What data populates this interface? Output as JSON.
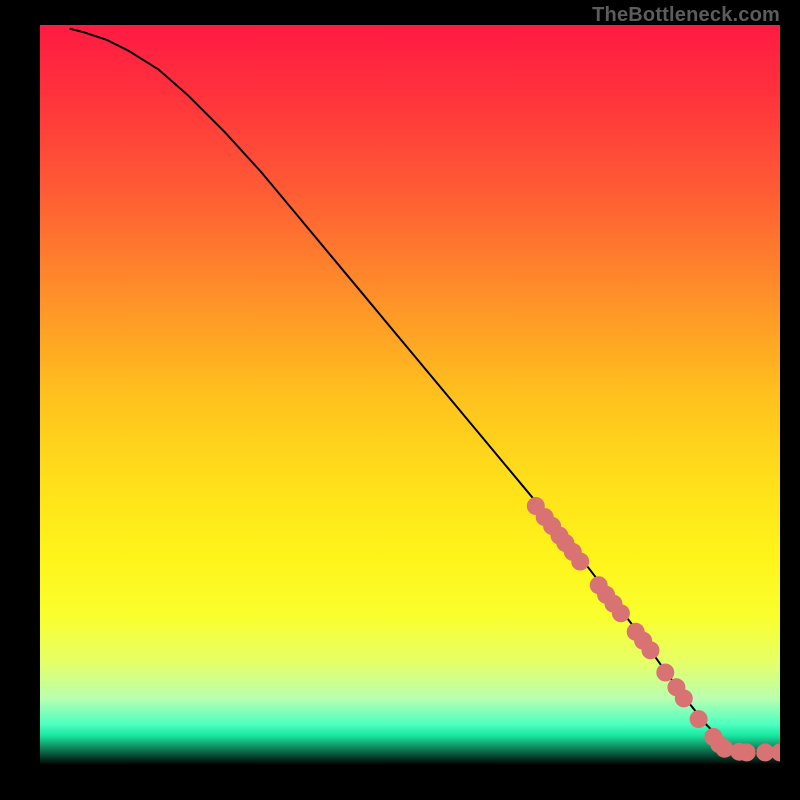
{
  "watermark": "TheBottleneck.com",
  "colors": {
    "frame": "#000000",
    "curve": "#000000",
    "point": "#d97373",
    "gradient_stops": [
      {
        "offset": 0.0,
        "color": "#ff1a42"
      },
      {
        "offset": 0.1,
        "color": "#ff343c"
      },
      {
        "offset": 0.22,
        "color": "#ff5a35"
      },
      {
        "offset": 0.35,
        "color": "#ff8a2a"
      },
      {
        "offset": 0.5,
        "color": "#ffc11e"
      },
      {
        "offset": 0.62,
        "color": "#ffe01a"
      },
      {
        "offset": 0.72,
        "color": "#fff41a"
      },
      {
        "offset": 0.8,
        "color": "#f9ff2e"
      },
      {
        "offset": 0.86,
        "color": "#e6ff66"
      },
      {
        "offset": 0.91,
        "color": "#b9ffb0"
      },
      {
        "offset": 0.945,
        "color": "#4dffc0"
      },
      {
        "offset": 0.96,
        "color": "#19e8a0"
      },
      {
        "offset": 1.0,
        "color": "#000000"
      }
    ]
  },
  "chart_data": {
    "type": "line",
    "title": "",
    "xlabel": "",
    "ylabel": "",
    "xlim": [
      0,
      100
    ],
    "ylim": [
      0,
      100
    ],
    "grid": false,
    "legend": false,
    "series": [
      {
        "name": "curve",
        "x": [
          4,
          6,
          9,
          12,
          16,
          20,
          25,
          30,
          35,
          40,
          45,
          50,
          55,
          60,
          65,
          70,
          75,
          80,
          85,
          88,
          90,
          92,
          94,
          96,
          98,
          100
        ],
        "y": [
          99.5,
          99,
          98,
          96.5,
          94,
          90.5,
          85.5,
          80,
          74,
          68,
          62,
          56,
          50,
          44,
          38,
          32,
          25.5,
          19,
          12,
          8,
          5.5,
          3.5,
          2.2,
          1.8,
          1.7,
          1.7
        ]
      }
    ],
    "points": [
      {
        "x": 67.0,
        "y": 35.0
      },
      {
        "x": 68.2,
        "y": 33.5
      },
      {
        "x": 69.2,
        "y": 32.3
      },
      {
        "x": 70.2,
        "y": 31.0
      },
      {
        "x": 71.0,
        "y": 30.0
      },
      {
        "x": 72.0,
        "y": 28.8
      },
      {
        "x": 73.0,
        "y": 27.5
      },
      {
        "x": 75.5,
        "y": 24.3
      },
      {
        "x": 76.5,
        "y": 23.0
      },
      {
        "x": 77.5,
        "y": 21.8
      },
      {
        "x": 78.5,
        "y": 20.5
      },
      {
        "x": 80.5,
        "y": 18.0
      },
      {
        "x": 81.5,
        "y": 16.8
      },
      {
        "x": 82.5,
        "y": 15.5
      },
      {
        "x": 84.5,
        "y": 12.5
      },
      {
        "x": 86.0,
        "y": 10.5
      },
      {
        "x": 87.0,
        "y": 9.0
      },
      {
        "x": 89.0,
        "y": 6.2
      },
      {
        "x": 91.0,
        "y": 3.8
      },
      {
        "x": 91.8,
        "y": 2.8
      },
      {
        "x": 92.5,
        "y": 2.2
      },
      {
        "x": 94.5,
        "y": 1.8
      },
      {
        "x": 95.5,
        "y": 1.7
      },
      {
        "x": 98.0,
        "y": 1.7
      },
      {
        "x": 100.0,
        "y": 1.7
      }
    ],
    "point_radius_px": 9
  }
}
